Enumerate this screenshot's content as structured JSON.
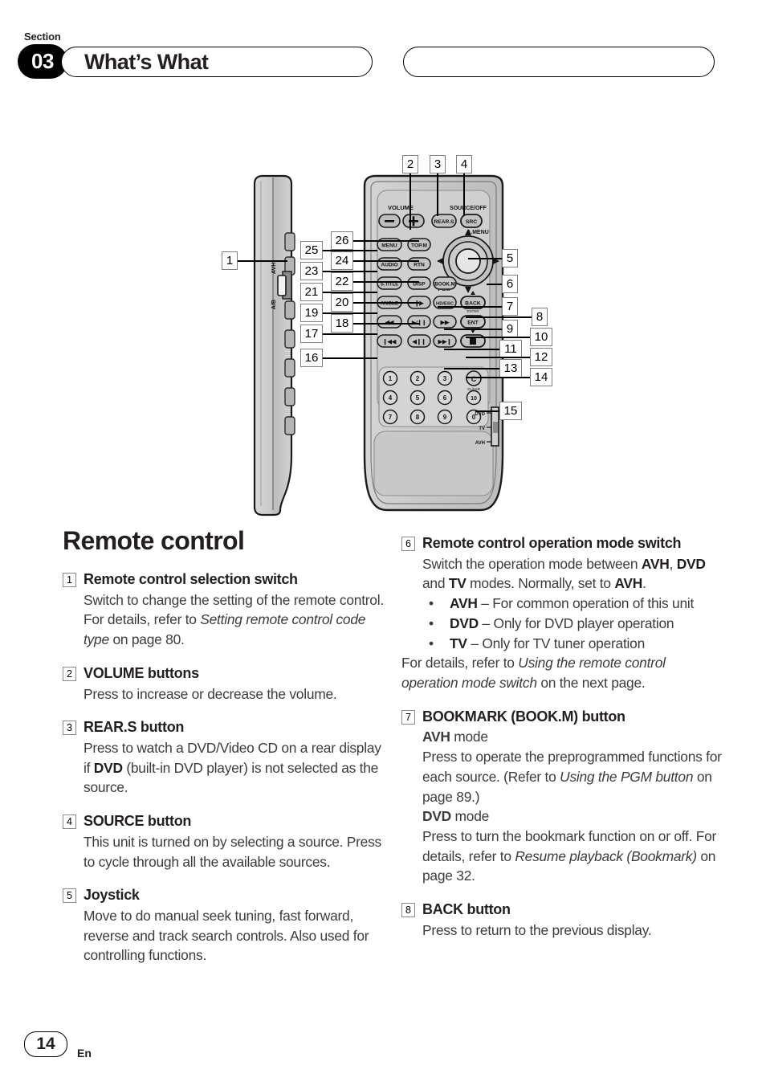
{
  "header": {
    "section_word": "Section",
    "section_number": "03",
    "title": "What’s What"
  },
  "figure": {
    "caption": "",
    "side_view": {
      "switch_labels": [
        "AVH",
        "A/B"
      ],
      "callout": "1"
    },
    "remote_labels": {
      "volume": "VOLUME",
      "source_off": "SOURCE/OFF",
      "a_menu": "A.MENU",
      "pgm": "PGM",
      "clear": "CLEAR",
      "mode_switch": [
        "DVD",
        "TV",
        "AVH"
      ]
    },
    "buttons": [
      "—",
      "+",
      "REAR.S",
      "SRC",
      "MENU",
      "TOP.M",
      "AUDIO",
      "RTN",
      "S.TITLE",
      "DISP",
      "ANGLE",
      "❙▶",
      "◀◀",
      "▶/❙❙",
      "❙◀◀",
      "◀❙❙",
      "BOOK.M",
      "HD/ESC",
      "BACK",
      "▶▶",
      "ENT",
      "▶▶❙",
      "■",
      "C"
    ],
    "keypad": [
      "1",
      "2",
      "3",
      "4",
      "5",
      "6",
      "10",
      "7",
      "8",
      "9",
      "0"
    ],
    "callouts_top": [
      "2",
      "3",
      "4"
    ],
    "callouts_right": [
      "5",
      "6",
      "7",
      "8",
      "9",
      "10",
      "11",
      "12",
      "13",
      "14",
      "15"
    ],
    "callouts_left": [
      "25",
      "26",
      "23",
      "24",
      "21",
      "22",
      "19",
      "20",
      "17",
      "18",
      "16"
    ]
  },
  "main": {
    "title": "Remote control",
    "left_entries": [
      {
        "num": "1",
        "title": "Remote control selection switch",
        "body": "Switch to change the setting of the remote control. For details, refer to <i>Setting remote control code type</i> on page 80."
      },
      {
        "num": "2",
        "title": "VOLUME buttons",
        "body": "Press to increase or decrease the volume."
      },
      {
        "num": "3",
        "title": "REAR.S button",
        "body": "Press to watch a DVD/Video CD on a rear display if <b>DVD</b> (built-in DVD player) is not selected as the source."
      },
      {
        "num": "4",
        "title": "SOURCE button",
        "body": "This unit is turned on by selecting a source. Press to cycle through all the available sources."
      },
      {
        "num": "5",
        "title": "Joystick",
        "body": "Move to do manual seek tuning, fast forward, reverse and track search controls. Also used for controlling functions."
      }
    ],
    "right_entries": [
      {
        "num": "6",
        "title": "Remote control operation mode switch",
        "body": "Switch the operation mode between <b>AVH</b>, <b>DVD</b> and <b>TV</b> modes. Normally, set to <b>AVH</b>.",
        "bullets": [
          "<b>AVH</b> – For common operation of this unit",
          "<b>DVD</b> – Only for DVD player operation",
          "<b>TV</b> – Only for TV tuner operation"
        ],
        "body2": "For details, refer to <i>Using the remote control operation mode switch</i> on the next page."
      },
      {
        "num": "7",
        "title": "BOOKMARK (BOOK.M) button",
        "mode1": "<b>AVH</b> mode",
        "body": "Press to operate the preprogrammed functions for each source. (Refer to <i>Using the PGM button</i> on page 89.)",
        "mode2": "<b>DVD</b> mode",
        "body2": "Press to turn the bookmark function on or off. For details, refer to <i>Resume playback (Bookmark)</i> on page 32."
      },
      {
        "num": "8",
        "title": "BACK button",
        "body": "Press to return to the previous display."
      }
    ]
  },
  "footer": {
    "page_number": "14",
    "language": "En"
  }
}
